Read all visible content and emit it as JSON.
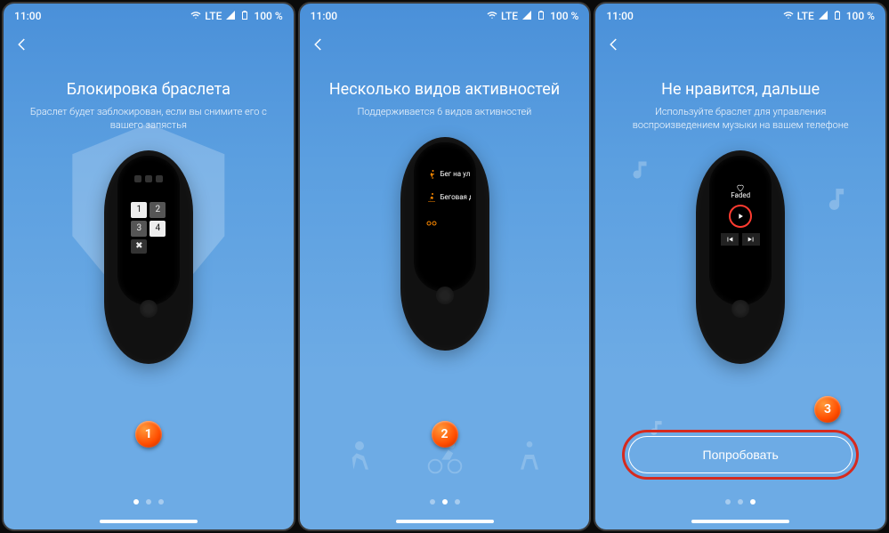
{
  "status": {
    "time": "11:00",
    "network": "LTE",
    "battery": "100 %"
  },
  "screens": [
    {
      "title": "Блокировка браслета",
      "subtitle": "Браслет будет заблокирован, если вы снимите его с вашего запястья",
      "step": "1",
      "activePage": 0,
      "keypad": {
        "k1": "1",
        "k2": "2",
        "k3": "3",
        "k4": "4",
        "kx": "✖"
      }
    },
    {
      "title": "Несколько видов активностей",
      "subtitle": "Поддерживается 6 видов активностей",
      "step": "2",
      "activePage": 1,
      "activities": {
        "a1": "Бег на ули",
        "a2": "Беговая до"
      }
    },
    {
      "title": "Не нравится, дальше",
      "subtitle": "Используйте браслет для управления воспроизведением музыки на вашем телефоне",
      "step": "3",
      "activePage": 2,
      "button": "Попробовать",
      "song": "Faded"
    }
  ]
}
